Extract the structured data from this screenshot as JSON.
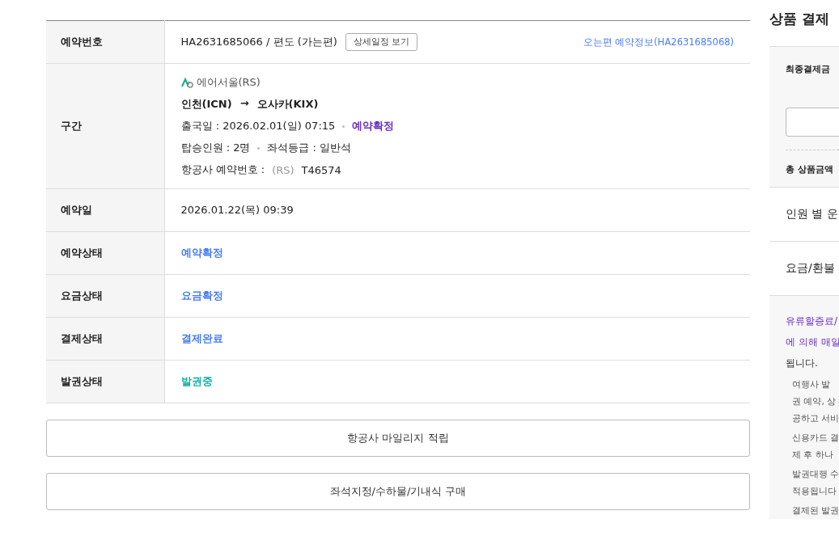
{
  "booking_table": {
    "rows": [
      {
        "kind": "booking_no",
        "label": "예약번호",
        "value": "HA2631685066 / 편도 (가는편)",
        "button": "상세일정 보기",
        "link": "오는편 예약정보(HA2631685068)"
      },
      {
        "kind": "segment",
        "label": "구간",
        "airline": "에어서울(RS)",
        "route_from": "인천(ICN)",
        "route_arrow": "→",
        "route_to": "오사카(KIX)",
        "departure": "출국일 : 2026.02.01(일) 07:15",
        "departure_status": "예약확정",
        "passengers": "탑승인원 : 2명",
        "seat_class": "좌석등급 : 일반석",
        "pnr_label": "항공사 예약번호 :",
        "pnr_code": "(RS)",
        "pnr": "T46574"
      },
      {
        "kind": "text",
        "label": "예약일",
        "value": "2026.01.22(목) 09:39"
      },
      {
        "kind": "status",
        "label": "예약상태",
        "value": "예약확정",
        "color": "#4a7cf7"
      },
      {
        "kind": "status",
        "label": "요금상태",
        "value": "요금확정",
        "color": "#4a7cf7"
      },
      {
        "kind": "status",
        "label": "결제상태",
        "value": "결제완료",
        "color": "#4a7cf7"
      },
      {
        "kind": "status",
        "label": "발권상태",
        "value": "발권중",
        "color": "#14b1a4"
      }
    ]
  },
  "actions": [
    "항공사 마일리지 적립",
    "좌석지정/수하물/기내식 구매"
  ],
  "payment_panel": {
    "title": "상품 결제",
    "final_amount_label": "최종결제금",
    "total_label": "총 상품금액",
    "sections": [
      "인원 별 운",
      "요금/환불"
    ],
    "notice": "유류할증료/",
    "notice_lines": [
      "에 의해 매일",
      "됩니다."
    ],
    "notes": [
      {
        "lines": [
          "여행사 발",
          "권 예약, 상",
          "공하고 서비"
        ]
      },
      {
        "lines": [
          "신용카드 결",
          "제 후 하나"
        ]
      },
      {
        "lines": [
          "발권대행 수",
          "적용됩니다"
        ]
      },
      {
        "lines": [
          "결제된 발권"
        ]
      }
    ]
  }
}
